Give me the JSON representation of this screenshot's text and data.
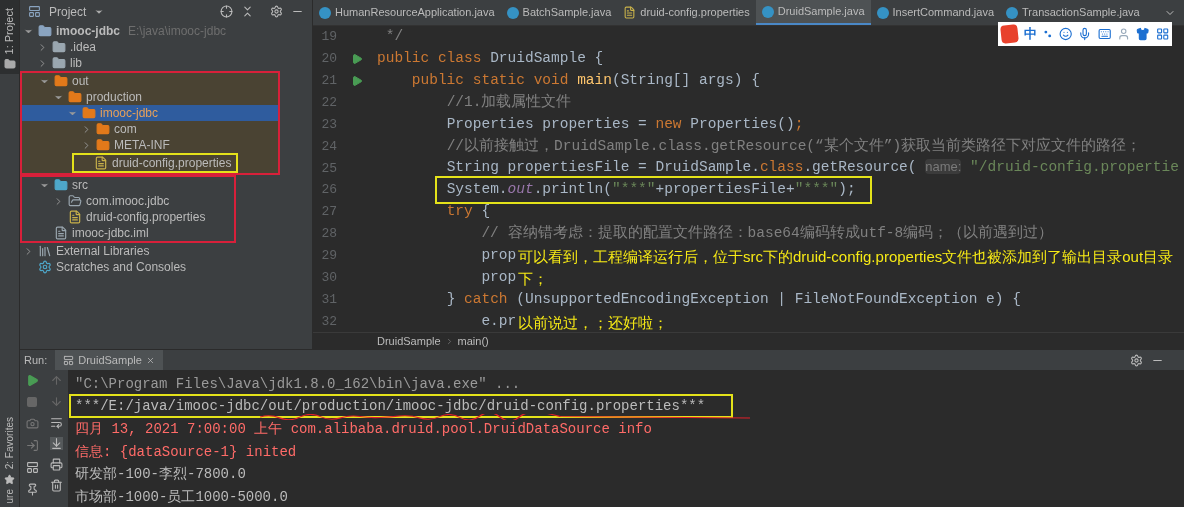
{
  "left_strip": {
    "top_label": "1: Project",
    "bottom_labels": [
      "2: Favorites",
      "ure"
    ]
  },
  "project_panel": {
    "title": "Project",
    "tree": [
      {
        "label": "imooc-jdbc",
        "path": "E:\\java\\imooc-jdbc",
        "kind": "module",
        "expanded": true,
        "selected": false,
        "excluded": false,
        "children": [
          {
            "label": ".idea",
            "kind": "folder",
            "expanded": false,
            "selected": false,
            "excluded": false
          },
          {
            "label": "lib",
            "kind": "folder",
            "expanded": false,
            "selected": false,
            "excluded": false
          },
          {
            "label": "out",
            "kind": "out-folder",
            "expanded": true,
            "selected": false,
            "excluded": true,
            "children": [
              {
                "label": "production",
                "kind": "out-folder",
                "expanded": true,
                "selected": false,
                "excluded": true,
                "children": [
                  {
                    "label": "imooc-jdbc",
                    "kind": "out-folder",
                    "expanded": true,
                    "selected": true,
                    "excluded": true,
                    "children": [
                      {
                        "label": "com",
                        "kind": "out-folder",
                        "expanded": false,
                        "selected": false,
                        "excluded": true
                      },
                      {
                        "label": "META-INF",
                        "kind": "out-folder",
                        "expanded": false,
                        "selected": false,
                        "excluded": true
                      },
                      {
                        "label": "druid-config.properties",
                        "kind": "properties",
                        "selected": false,
                        "excluded": true
                      }
                    ]
                  }
                ]
              }
            ]
          },
          {
            "label": "src",
            "kind": "source-folder",
            "expanded": true,
            "selected": false,
            "excluded": false,
            "children": [
              {
                "label": "com.imooc.jdbc",
                "kind": "package",
                "expanded": false,
                "selected": false,
                "excluded": false
              },
              {
                "label": "druid-config.properties",
                "kind": "properties",
                "selected": false,
                "excluded": false
              }
            ]
          },
          {
            "label": "imooc-jdbc.iml",
            "kind": "iml",
            "selected": false,
            "excluded": false
          }
        ]
      },
      {
        "label": "External Libraries",
        "kind": "libraries",
        "expanded": false,
        "selected": false,
        "excluded": false
      },
      {
        "label": "Scratches and Consoles",
        "kind": "scratches",
        "selected": false,
        "excluded": false
      }
    ]
  },
  "editor": {
    "tabs": [
      {
        "label": "HumanResourceApplication.java",
        "kind": "java",
        "selected": false
      },
      {
        "label": "BatchSample.java",
        "kind": "java",
        "selected": false
      },
      {
        "label": "druid-config.properties",
        "kind": "properties",
        "selected": false
      },
      {
        "label": "DruidSample.java",
        "kind": "java",
        "selected": true
      },
      {
        "label": "InsertCommand.java",
        "kind": "java",
        "selected": false
      },
      {
        "label": "TransactionSample.java",
        "kind": "java",
        "selected": false
      }
    ],
    "lines": [
      {
        "number": "19",
        "run": false,
        "tokens": [
          {
            "text": " */",
            "kind": "comment"
          }
        ]
      },
      {
        "number": "20",
        "run": true,
        "tokens": [
          {
            "text": "public class ",
            "kind": "keyword"
          },
          {
            "text": "DruidSample {",
            "kind": "plain"
          }
        ]
      },
      {
        "number": "21",
        "run": true,
        "tokens": [
          {
            "text": "    public static void ",
            "kind": "keyword"
          },
          {
            "text": "main",
            "kind": "method"
          },
          {
            "text": "(String[] args) {",
            "kind": "plain"
          }
        ]
      },
      {
        "number": "22",
        "run": false,
        "tokens": [
          {
            "text": "        //1.加载属性文件",
            "kind": "comment"
          }
        ]
      },
      {
        "number": "23",
        "run": false,
        "tokens": [
          {
            "text": "        Properties properties = ",
            "kind": "plain"
          },
          {
            "text": "new ",
            "kind": "keyword"
          },
          {
            "text": "Properties()",
            "kind": "plain"
          },
          {
            "text": ";",
            "kind": "keyword"
          }
        ]
      },
      {
        "number": "24",
        "run": false,
        "tokens": [
          {
            "text": "        //以前接触过，DruidSample.class.getResource(“某个文件”)获取当前类路径下对应文件的路径；",
            "kind": "comment"
          }
        ]
      },
      {
        "number": "25",
        "run": false,
        "tokens": [
          {
            "text": "        String propertiesFile = DruidSample.",
            "kind": "plain"
          },
          {
            "text": "class",
            "kind": "keyword"
          },
          {
            "text": ".getResource( ",
            "kind": "plain"
          },
          {
            "text": "name:",
            "kind": "hint"
          },
          {
            "text": " \"/druid-config.propertie",
            "kind": "string"
          }
        ]
      },
      {
        "number": "26",
        "run": false,
        "tokens": [
          {
            "text": "        System.",
            "kind": "plain"
          },
          {
            "text": "out",
            "kind": "field"
          },
          {
            "text": ".println(",
            "kind": "plain"
          },
          {
            "text": "\"***\"",
            "kind": "string"
          },
          {
            "text": "+propertiesFile+",
            "kind": "plain"
          },
          {
            "text": "\"***\"",
            "kind": "string"
          },
          {
            "text": ");",
            "kind": "plain"
          }
        ]
      },
      {
        "number": "27",
        "run": false,
        "tokens": [
          {
            "text": "        try",
            "kind": "keyword"
          },
          {
            "text": " {",
            "kind": "plain"
          }
        ]
      },
      {
        "number": "28",
        "run": false,
        "tokens": [
          {
            "text": "            // 容纳错考虑：提取的配置文件路径：base64编码转成utf-8编码；（以前遇到过）",
            "kind": "comment"
          }
        ]
      },
      {
        "number": "29",
        "run": false,
        "tokens": [
          {
            "text": "            prop",
            "kind": "plain"
          }
        ]
      },
      {
        "number": "30",
        "run": false,
        "tokens": [
          {
            "text": "            prop",
            "kind": "plain"
          }
        ]
      },
      {
        "number": "31",
        "run": false,
        "tokens": [
          {
            "text": "        } ",
            "kind": "plain"
          },
          {
            "text": "catch",
            "kind": "keyword"
          },
          {
            "text": " (UnsupportedEncodingException | FileNotFoundException e) {",
            "kind": "plain"
          }
        ]
      },
      {
        "number": "32",
        "run": false,
        "tokens": [
          {
            "text": "            e.pr",
            "kind": "plain"
          }
        ]
      }
    ],
    "annotations": [
      "可以看到，工程编译运行后，位于src下的druid-config.properties文件也被添加到了输出目录out目录下；",
      "以前说过，；还好啦；"
    ],
    "breadcrumb": [
      "DruidSample",
      "main()"
    ]
  },
  "ime_toolbar": {
    "mode": "中"
  },
  "run_panel": {
    "label": "Run:",
    "tab": "DruidSample",
    "console": [
      {
        "text": "\"C:\\Program Files\\Java\\jdk1.8.0_162\\bin\\java.exe\" ...",
        "kind": "command"
      },
      {
        "text": "***/E:/java/imooc-jdbc/out/production/imooc-jdbc/druid-config.properties***",
        "kind": "stdout"
      },
      {
        "text": "四月 13, 2021 7:00:00 上午 com.alibaba.druid.pool.DruidDataSource info",
        "kind": "stderr"
      },
      {
        "text": "信息: {dataSource-1} inited",
        "kind": "stderr"
      },
      {
        "text": "研发部-100-李烈-7800.0",
        "kind": "stdout"
      },
      {
        "text": "市场部-1000-员工1000-5000.0",
        "kind": "stdout"
      }
    ]
  }
}
